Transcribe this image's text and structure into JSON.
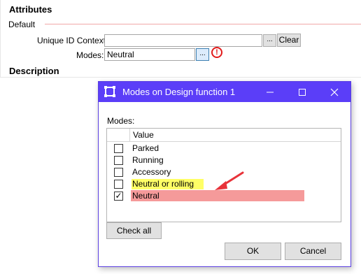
{
  "panel": {
    "title": "Attributes",
    "section": "Default",
    "unique_id_label": "Unique ID Context:",
    "unique_id_value": "",
    "dots": "...",
    "clear_label": "Clear",
    "modes_label": "Modes:",
    "modes_value": "Neutral",
    "warn_symbol": "!",
    "description_heading": "Description"
  },
  "dialog": {
    "title": "Modes on Design function 1",
    "minimize": "—",
    "maximize": "☐",
    "close": "✕",
    "modes_label": "Modes:",
    "column_value": "Value",
    "rows": [
      {
        "label": "Parked",
        "checked": false
      },
      {
        "label": "Running",
        "checked": false
      },
      {
        "label": "Accessory",
        "checked": false
      },
      {
        "label": "Neutral or rolling",
        "checked": false
      },
      {
        "label": "Neutral",
        "checked": true
      }
    ],
    "check_mark": "✓",
    "check_all": "Check all",
    "ok": "OK",
    "cancel": "Cancel"
  },
  "colors": {
    "accent": "#5b3ef8",
    "highlight_yellow": "#ffff66",
    "highlight_red": "#f59a9a",
    "arrow": "#e8333a"
  }
}
